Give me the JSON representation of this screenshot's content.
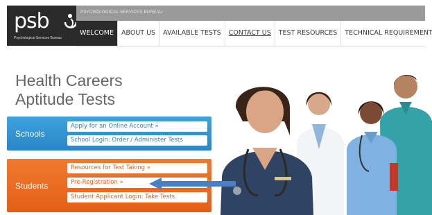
{
  "header": {
    "logo_text": "psb",
    "logo_tagline": "Psychological Services Bureau",
    "topbar_text": "PSYCHOLOGICAL SERVICES BUREAU",
    "nav": [
      {
        "label": "WELCOME",
        "active": true
      },
      {
        "label": "ABOUT US"
      },
      {
        "label": "AVAILABLE TESTS"
      },
      {
        "label": "CONTACT US",
        "underlined": true
      },
      {
        "label": "TEST RESOURCES"
      },
      {
        "label": "TECHNICAL REQUIREMENTS"
      }
    ]
  },
  "hero": {
    "headline_line1": "Health Careers",
    "headline_line2": "Aptitude Tests"
  },
  "schools": {
    "label": "Schools",
    "links": [
      "Apply for an Online Account »",
      "School Login: Order / Administer Tests"
    ]
  },
  "students": {
    "label": "Students",
    "links": [
      "Resources for Test Taking »",
      "Pre-Registration »",
      "Student Applicant Login: Take Tests"
    ]
  },
  "colors": {
    "brand_dark": "#2a2a2a",
    "schools_blue": "#2a86c7",
    "students_orange": "#e35f18",
    "arrow_blue": "#4a7fc1"
  }
}
